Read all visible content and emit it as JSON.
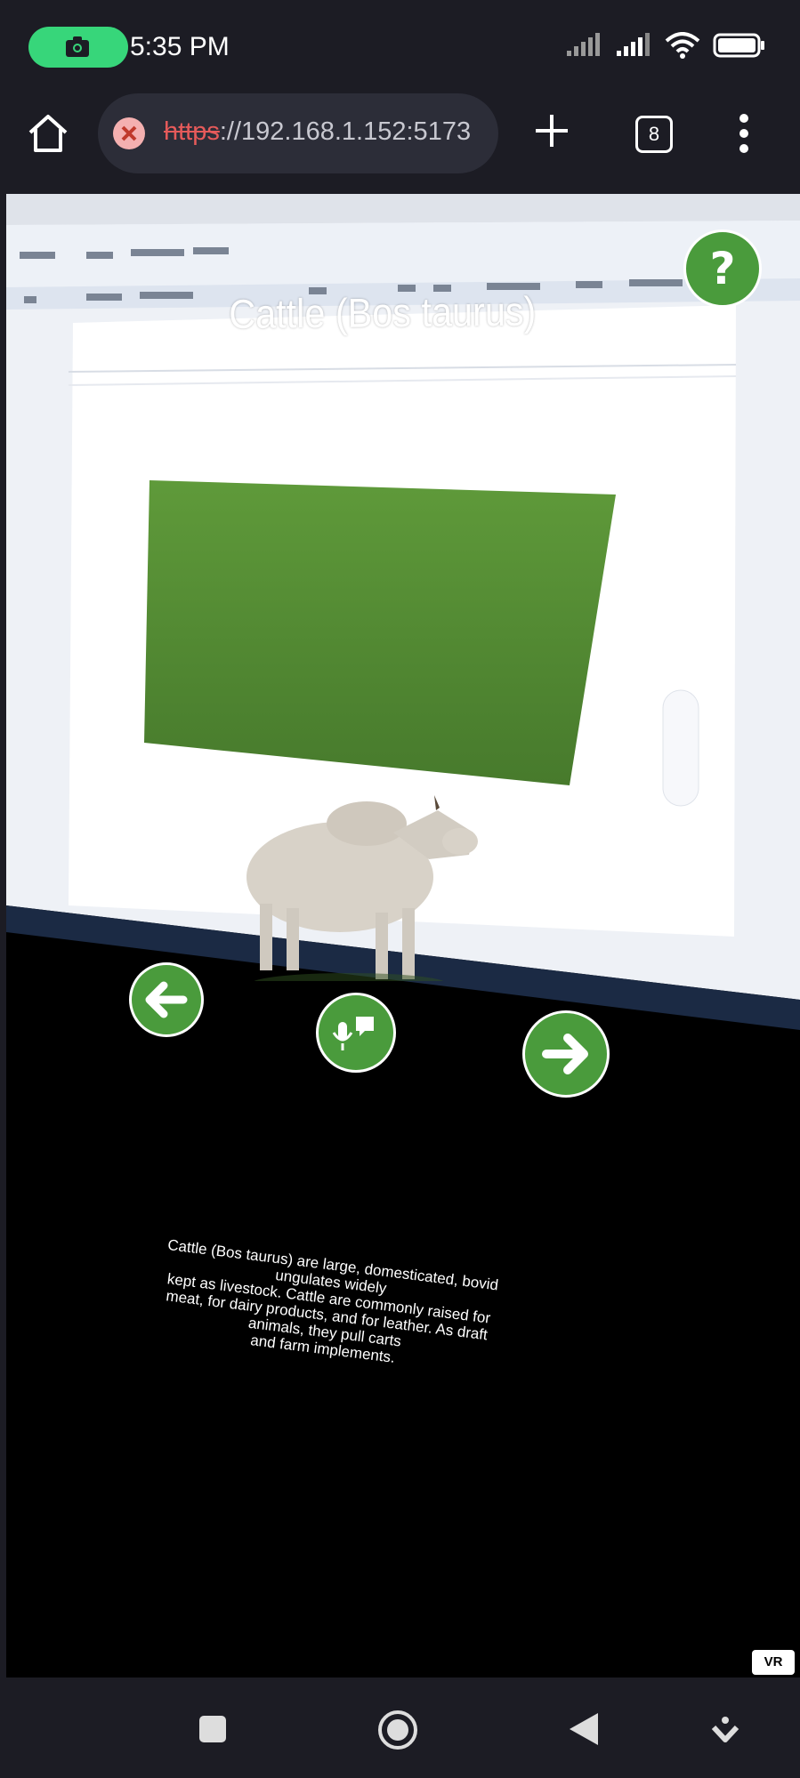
{
  "status_bar": {
    "time": "5:35 PM",
    "icons": [
      "camera-icon",
      "signal-icon",
      "signal-icon",
      "wifi-icon",
      "battery-icon"
    ]
  },
  "browser": {
    "url_scheme": "https",
    "url_rest": "://192.168.1.152:5173",
    "tab_count": "8",
    "icons": [
      "home-icon",
      "insecure-icon",
      "new-tab-icon",
      "menu-icon"
    ]
  },
  "viewer": {
    "title": "Cattle (Bos taurus)",
    "description_lines": [
      "Cattle (Bos taurus) are large, domesticated, bovid",
      "ungulates widely",
      "kept as livestock. Cattle are commonly raised for",
      "meat, for dairy products, and for leather. As draft",
      "animals, they pull carts",
      "and farm implements."
    ],
    "vr_label": "VR",
    "accent": "#4a9b3c",
    "icons": [
      "help-icon",
      "back-arrow-icon",
      "voice-icon",
      "forward-arrow-icon"
    ]
  },
  "system_nav": {
    "icons": [
      "recents-icon",
      "home-circle-icon",
      "back-triangle-icon",
      "download-icon"
    ]
  }
}
